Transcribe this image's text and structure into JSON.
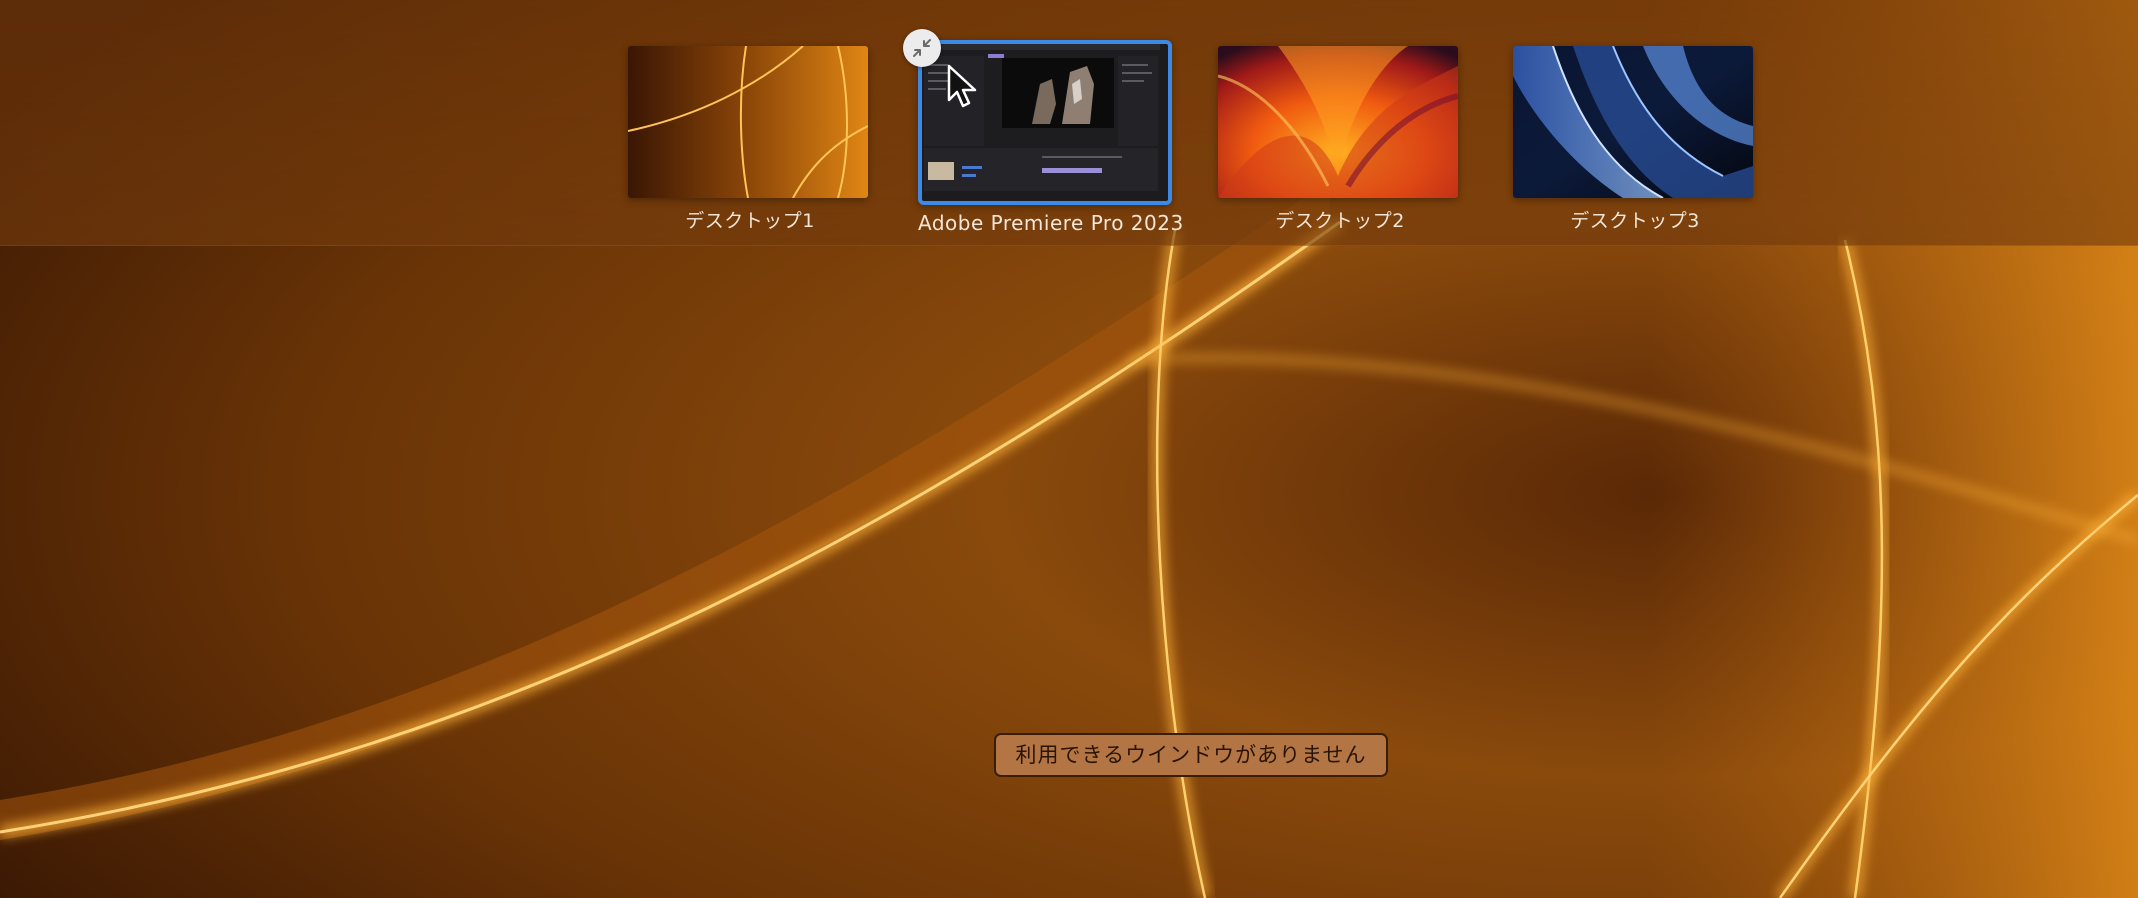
{
  "spaces": [
    {
      "label": "デスクトップ1"
    },
    {
      "label": "Adobe Premiere Pro 2023",
      "selected": true
    },
    {
      "label": "デスクトップ2"
    },
    {
      "label": "デスクトップ3"
    }
  ],
  "exit_fullscreen_icon": "exit-fullscreen-icon",
  "empty_state": {
    "message": "利用できるウインドウがありません"
  },
  "colors": {
    "selection_border": "#3d8ae6",
    "wallpaper_base": "#6a3206",
    "badge_background": "#b27543"
  }
}
